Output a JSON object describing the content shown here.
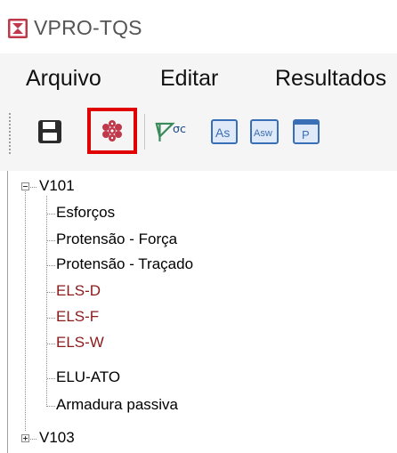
{
  "window": {
    "title": "VPRO-TQS"
  },
  "menu": {
    "items": [
      {
        "label": "Arquivo"
      },
      {
        "label": "Editar"
      },
      {
        "label": "Resultados"
      }
    ]
  },
  "toolbar": {
    "buttons": [
      {
        "icon": "save-icon"
      },
      {
        "icon": "model-3d-icon",
        "highlighted": true
      },
      {
        "icon": "stress-diagram-icon",
        "label": "σc"
      },
      {
        "icon": "as-icon",
        "label": "As"
      },
      {
        "icon": "asw-icon",
        "label": "Asw"
      },
      {
        "icon": "p-icon",
        "label": "P"
      }
    ]
  },
  "tree": {
    "nodes": [
      {
        "label": "V101",
        "expanded": true,
        "children": [
          {
            "label": "Esforços",
            "color": "#000000"
          },
          {
            "label": "Protensão - Força",
            "color": "#000000"
          },
          {
            "label": "Protensão - Traçado",
            "color": "#000000"
          },
          {
            "label": "ELS-D",
            "color": "#8b1a1a"
          },
          {
            "label": "ELS-F",
            "color": "#8b1a1a"
          },
          {
            "label": "ELS-W",
            "color": "#8b1a1a"
          },
          {
            "label": "ELU-ATO",
            "color": "#000000"
          },
          {
            "label": "Armadura passiva",
            "color": "#000000"
          }
        ]
      },
      {
        "label": "V103",
        "expanded": false,
        "children": []
      }
    ]
  },
  "colors": {
    "highlight_border": "#e00000",
    "icon_red": "#c0394b",
    "icon_blue": "#3b6fb5",
    "tree_red_text": "#8b1a1a"
  }
}
